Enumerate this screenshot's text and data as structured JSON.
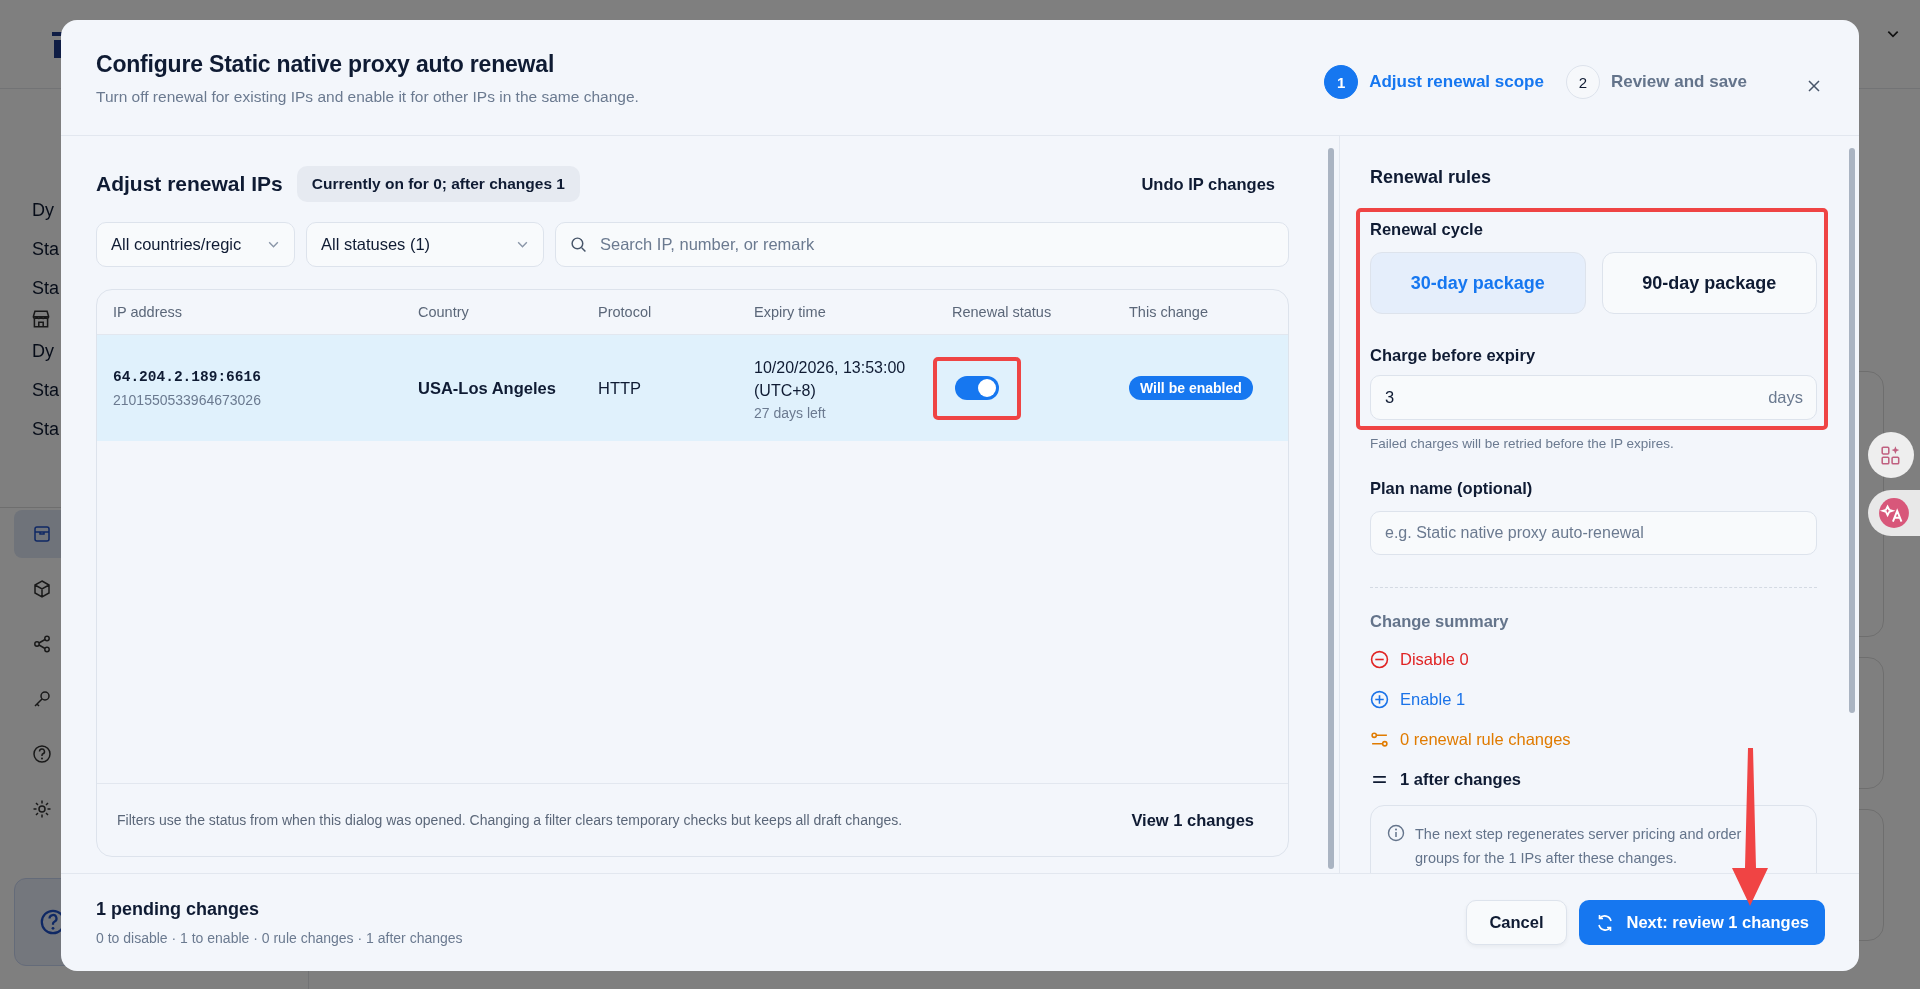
{
  "background": {
    "upper_items": [
      "Dy",
      "Sta",
      "Sta"
    ],
    "lower_items": [
      "Dy",
      "Sta",
      "Sta"
    ],
    "icon_items": [
      {
        "selected": true
      },
      {
        "selected": false
      },
      {
        "selected": false
      },
      {
        "selected": false
      },
      {
        "selected": false
      },
      {
        "selected": false
      }
    ]
  },
  "dialog": {
    "title": "Configure Static native proxy auto renewal",
    "subtitle": "Turn off renewal for existing IPs and enable it for other IPs in the same change.",
    "steps": [
      {
        "number": "1",
        "label": "Adjust renewal scope",
        "active": true
      },
      {
        "number": "2",
        "label": "Review and save",
        "active": false
      }
    ]
  },
  "ip_panel": {
    "title": "Adjust renewal IPs",
    "count_badge": "Currently on for 0; after changes 1",
    "undo_button": "Undo IP changes",
    "country_filter": "All countries/regic",
    "status_filter": "All statuses (1)",
    "search": {
      "placeholder": "Search IP, number, or remark"
    },
    "table": {
      "columns": [
        "IP address",
        "Country",
        "Protocol",
        "Expiry time",
        "Renewal status",
        "This change"
      ],
      "rows": [
        {
          "ip": "64.204.2.189:6616",
          "number": "2101550533964673026",
          "country": "USA-Los Angeles",
          "protocol": "HTTP",
          "expiry": "10/20/2026, 13:53:00 (UTC+8)",
          "remaining": "27 days left",
          "renewal_on": true,
          "change": "Will be enabled",
          "selected": true
        }
      ]
    },
    "footer_note": "Filters use the status from when this dialog was opened. Changing a filter clears temporary checks but keeps all draft changes.",
    "view_button": "View 1 changes"
  },
  "rules_panel": {
    "title": "Renewal rules",
    "cycle_label": "Renewal cycle",
    "cycle_options": [
      {
        "label": "30-day package",
        "selected": true
      },
      {
        "label": "90-day package",
        "selected": false
      }
    ],
    "charge_label": "Charge before expiry",
    "charge_value": "3",
    "charge_unit": "days",
    "charge_help": "Failed charges will be retried before the IP expires.",
    "plan_label": "Plan name (optional)",
    "plan_placeholder": "e.g. Static native proxy auto-renewal",
    "summary_title": "Change summary",
    "summary": [
      {
        "kind": "disable",
        "text": "Disable 0"
      },
      {
        "kind": "enable",
        "text": "Enable 1"
      },
      {
        "kind": "rules",
        "text": "0 renewal rule changes"
      },
      {
        "kind": "total",
        "text": "1 after changes"
      }
    ],
    "info": "The next step regenerates server pricing and order groups for the 1 IPs after these changes."
  },
  "footer": {
    "title": "1 pending changes",
    "details": "0 to disable · 1 to enable · 0 rule changes · 1 after changes",
    "cancel": "Cancel",
    "next": "Next: review 1 changes"
  }
}
